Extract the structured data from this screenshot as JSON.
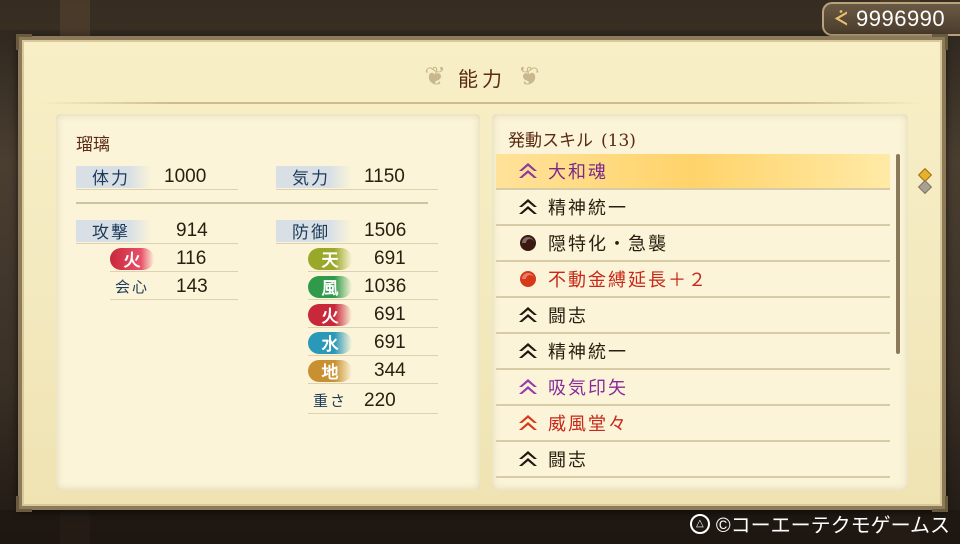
{
  "money": {
    "icon": "coin-icon",
    "value": "9996990"
  },
  "panel": {
    "title": "能力"
  },
  "character": {
    "name": "瑠璃",
    "hp_label": "体力",
    "hp_value": "1000",
    "ki_label": "気力",
    "ki_value": "1150",
    "attack_label": "攻撃",
    "attack_value": "914",
    "defense_label": "防御",
    "defense_value": "1506",
    "attack_elements": [
      {
        "label": "火",
        "value": "116",
        "color": "#c8283a"
      }
    ],
    "crit_label": "会心",
    "crit_value": "143",
    "defense_elements": [
      {
        "label": "天",
        "value": "691",
        "color": "#9aa82a"
      },
      {
        "label": "風",
        "value": "1036",
        "color": "#2e9a4a"
      },
      {
        "label": "火",
        "value": "691",
        "color": "#c8283a"
      },
      {
        "label": "水",
        "value": "691",
        "color": "#2a98b8"
      },
      {
        "label": "地",
        "value": "344",
        "color": "#c89030"
      }
    ],
    "weight_label": "重さ",
    "weight_value": "220"
  },
  "skills": {
    "header": "発動スキル",
    "count": "(13)",
    "items": [
      {
        "label": "大和魂",
        "color": "#7a2a8a",
        "icon": "purple-chevron-icon",
        "iconColor": "#8a3a9a",
        "selected": true
      },
      {
        "label": "精神統一",
        "color": "#2a1e10",
        "icon": "black-chevron-icon",
        "iconColor": "#1e1810"
      },
      {
        "label": "隠特化・急襲",
        "color": "#2a1e10",
        "icon": "dark-orb-icon",
        "iconColor": "#3a1a10"
      },
      {
        "label": "不動金縛延長＋２",
        "color": "#c8281a",
        "icon": "red-orb-icon",
        "iconColor": "#d8381a"
      },
      {
        "label": "闘志",
        "color": "#2a1e10",
        "icon": "black-chevron-icon",
        "iconColor": "#1e1810"
      },
      {
        "label": "精神統一",
        "color": "#2a1e10",
        "icon": "black-chevron-icon",
        "iconColor": "#1e1810"
      },
      {
        "label": "吸気印矢",
        "color": "#8a2a9a",
        "icon": "purple-chevron-icon",
        "iconColor": "#9a3aaa"
      },
      {
        "label": "威風堂々",
        "color": "#c8281a",
        "icon": "red-chevron-icon",
        "iconColor": "#d8381a"
      },
      {
        "label": "闘志",
        "color": "#2a1e10",
        "icon": "black-chevron-icon",
        "iconColor": "#1e1810"
      }
    ]
  },
  "footer": {
    "button_icon": "triangle-button-icon",
    "copyright": "©コーエーテクモゲームス"
  }
}
